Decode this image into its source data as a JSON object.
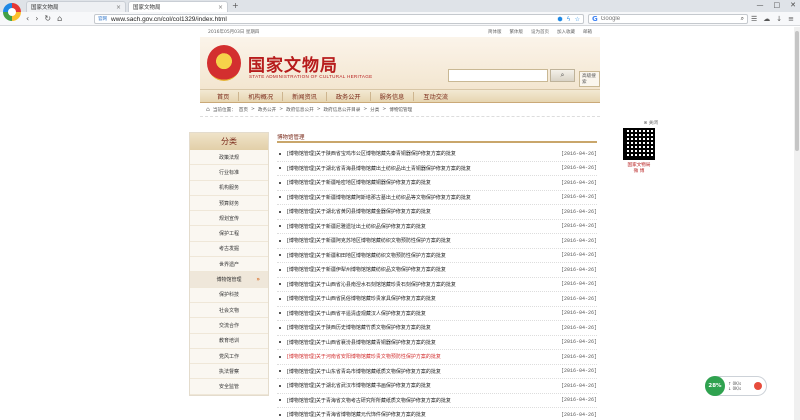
{
  "browser": {
    "tabs": [
      {
        "label": "国家文物局",
        "active": false
      },
      {
        "label": "国家文物局",
        "active": true
      }
    ],
    "new_tab": "+",
    "window_controls": [
      "—",
      "□",
      "✕"
    ],
    "nav": [
      "‹",
      "›",
      "↻",
      "⌂"
    ],
    "url_badge": "官网",
    "url": "www.sach.gov.cn/col/col1329/index.html",
    "search_engine": "Google",
    "search_placeholder": "Google"
  },
  "topbar": {
    "date": "2016年05月03日 星期四",
    "links": [
      "简体版",
      "繁体版",
      "设为首页",
      "加入收藏",
      "邮箱"
    ]
  },
  "header": {
    "title": "国家文物局",
    "subtitle": "STATE ADMINISTRATION OF CULTURAL HERITAGE",
    "adv_search": "高级搜索"
  },
  "mainnav": [
    "首页",
    "机构概况",
    "新闻资讯",
    "政务公开",
    "服务信息",
    "互动交流"
  ],
  "breadcrumb": {
    "prefix": "当前位置：",
    "items": [
      "首页",
      ">",
      "政务公开",
      ">",
      "政府信息公开",
      ">",
      "政府信息公开目录",
      ">",
      "分类",
      ">",
      "博物馆管理"
    ]
  },
  "sidebar": {
    "heading": "分类",
    "items": [
      "政策法规",
      "行业标准",
      "机构服务",
      "预算财务",
      "规划宣传",
      "保护工程",
      "考古发掘",
      "世界遗产",
      "博物馆管理",
      "保护科技",
      "社会文物",
      "交流合作",
      "教育培训",
      "党风工作",
      "执法督察",
      "安全监管"
    ],
    "active_index": 8,
    "active_arrow": "»"
  },
  "list": {
    "heading": "博物馆管理",
    "items": [
      {
        "title": "[博物馆管理]关于陕西省宝鸡市公区博物馆藏先秦青铜器保护修复方案的批复",
        "date": "[2016-04-26]"
      },
      {
        "title": "[博物馆管理]关于湖北省青海县博物馆藏出土纺织品出土青铜器保护修复方案的批复",
        "date": "[2016-04-26]"
      },
      {
        "title": "[博物馆管理]关于新疆哈密地区博物馆藏铜器保护修复方案的批复",
        "date": "[2016-04-26]"
      },
      {
        "title": "[博物馆管理]关于新疆博物馆藏阿斯塔那古墓出土纺织品等文物保护修复方案的批复",
        "date": "[2016-04-26]"
      },
      {
        "title": "[博物馆管理]关于湖北省黄冈县博物馆藏金器保护修复方案的批复",
        "date": "[2016-04-26]"
      },
      {
        "title": "[博物馆管理]关于新疆尼雅遗址出土纺织品保护修复方案的批复",
        "date": "[2016-04-26]"
      },
      {
        "title": "[博物馆管理]关于新疆阿克苏地区博物馆藏纺织文物预防性保护方案的批复",
        "date": "[2016-04-26]"
      },
      {
        "title": "[博物馆管理]关于新疆和田地区博物馆藏纺织文物预防性保护方案的批复",
        "date": "[2016-04-26]"
      },
      {
        "title": "[博物馆管理]关于新疆伊犁州博物馆馆藏纺织品文物保护修复方案的批复",
        "date": "[2016-04-26]"
      },
      {
        "title": "[博物馆管理]关于山西省沁县南涅水石刻馆馆藏珍贵石刻保护修复方案的批复",
        "date": "[2016-04-26]"
      },
      {
        "title": "[博物馆管理]关于山西省民俗博物馆藏珍贵家具保护修复方案的批复",
        "date": "[2016-04-26]"
      },
      {
        "title": "[博物馆管理]关于山西省平遥清虚观藏汉人保护修复方案的批复",
        "date": "[2016-04-26]"
      },
      {
        "title": "[博物馆管理]关于陕西历史博物馆藏竹质文物保护修复方案的批复",
        "date": "[2016-04-26]"
      },
      {
        "title": "[博物馆管理]关于山西省襄汾县博物馆藏青铜器保护修复方案的批复",
        "date": "[2016-04-26]"
      },
      {
        "title": "[博物馆管理]关于河南省安阳博物馆藏珍贵文物预防性保护方案的批复",
        "date": "[2016-04-26]",
        "red": true
      },
      {
        "title": "[博物馆管理]关于山东省青岛市博物馆藏纸质文物保护修复方案的批复",
        "date": "[2016-04-26]"
      },
      {
        "title": "[博物馆管理]关于湖北省武汉市博物馆藏书画保护修复方案的批复",
        "date": "[2016-04-26]"
      },
      {
        "title": "[博物馆管理]关于青海省文物考古研究所所藏纸质文物保护修复方案的批复",
        "date": "[2016-04-26]"
      },
      {
        "title": "[博物馆管理]关于青海省博物馆藏元代饰件保护修复方案的批复",
        "date": "[2016-04-26]"
      }
    ]
  },
  "qr": {
    "close": "⊗ 关闭",
    "label_line1": "国家文物局",
    "label_line2": "微 博"
  },
  "speed_widget": {
    "percent": "28%",
    "up": "0K/s",
    "down": "0K/s"
  },
  "colors": {
    "brand_red": "#b71c1c",
    "nav_gold": "#e6d5b1",
    "highlight_red": "#d32f2f"
  }
}
